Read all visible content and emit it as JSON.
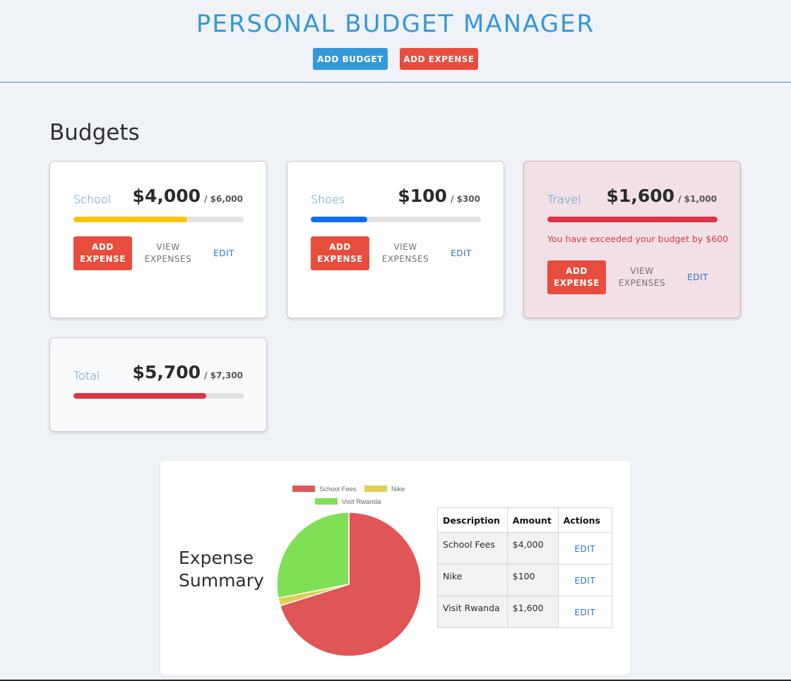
{
  "header": {
    "title": "PERSONAL BUDGET MANAGER",
    "add_budget_label": "ADD BUDGET",
    "add_expense_label": "ADD EXPENSE"
  },
  "budgets_title": "Budgets",
  "budgets": [
    {
      "name": "School",
      "spent": "$4,000",
      "max": "/ $6,000",
      "progress": 0.667,
      "bar_color": "#ffc107",
      "add_label": "ADD EXPENSE",
      "view_label": "VIEW EXPENSES",
      "edit_label": "EDIT"
    },
    {
      "name": "Shoes",
      "spent": "$100",
      "max": "/ $300",
      "progress": 0.333,
      "bar_color": "#0d6efd",
      "add_label": "ADD EXPENSE",
      "view_label": "VIEW EXPENSES",
      "edit_label": "EDIT"
    },
    {
      "name": "Travel",
      "spent": "$1,600",
      "max": "/ $1,000",
      "progress": 1.0,
      "bar_color": "#dc3545",
      "warning": "You have exceeded your budget by $600",
      "add_label": "ADD EXPENSE",
      "view_label": "VIEW EXPENSES",
      "edit_label": "EDIT"
    }
  ],
  "total": {
    "name": "Total",
    "spent": "$5,700",
    "max": "/ $7,300",
    "progress": 0.781,
    "bar_color": "#dc3545"
  },
  "summary": {
    "title": "Expense Summary",
    "table": {
      "headers": [
        "Description",
        "Amount",
        "Actions"
      ],
      "rows": [
        {
          "description": "School Fees",
          "amount": "$4,000",
          "action": "EDIT"
        },
        {
          "description": "Nike",
          "amount": "$100",
          "action": "EDIT"
        },
        {
          "description": "Visit Rwanda",
          "amount": "$1,600",
          "action": "EDIT"
        }
      ]
    }
  },
  "chart_data": {
    "type": "pie",
    "labels": [
      "School Fees",
      "Nike",
      "Visit Rwanda"
    ],
    "values": [
      4000,
      100,
      1600
    ],
    "colors": [
      "#e05555",
      "#e0cf55",
      "#80e055"
    ],
    "legend": "top"
  }
}
